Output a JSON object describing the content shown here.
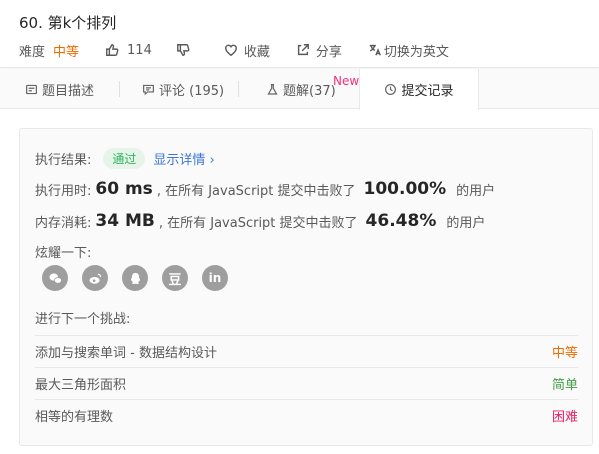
{
  "problem": {
    "title": "60. 第k个排列",
    "difficulty_label": "难度",
    "difficulty": "中等",
    "likes": "114",
    "favorite_label": "收藏",
    "share_label": "分享",
    "switch_lang_label": "切换为英文"
  },
  "tabs": [
    {
      "label": "题目描述",
      "icon": "description-icon"
    },
    {
      "label": "评论 (195)",
      "icon": "comment-icon"
    },
    {
      "label": "题解(37)",
      "icon": "flask-icon",
      "badge": "New"
    },
    {
      "label": "提交记录",
      "icon": "clock-icon",
      "active": true
    }
  ],
  "result": {
    "status_label": "执行结果:",
    "status": "通过",
    "details_link": "显示详情 ›",
    "runtime_label": "执行用时:",
    "runtime_value": "60 ms",
    "runtime_text": ", 在所有 JavaScript 提交中击败了",
    "runtime_percent": "100.00%",
    "runtime_suffix": "的用户",
    "memory_label": "内存消耗:",
    "memory_value": "34 MB",
    "memory_text": ", 在所有 JavaScript 提交中击败了",
    "memory_percent": "46.48%",
    "memory_suffix": "的用户",
    "share_label": "炫耀一下:",
    "share_icons": [
      "wechat-icon",
      "weibo-icon",
      "qq-icon",
      "douban-icon",
      "linkedin-icon"
    ],
    "douban_glyph": "豆",
    "linkedin_glyph": "in"
  },
  "next": {
    "label": "进行下一个挑战:",
    "items": [
      {
        "name": "添加与搜索单词 - 数据结构设计",
        "difficulty": "中等"
      },
      {
        "name": "最大三角形面积",
        "difficulty": "简单"
      },
      {
        "name": "相等的有理数",
        "difficulty": "困难"
      }
    ]
  },
  "colors": {
    "medium": "#ef6c00",
    "easy": "#43a047",
    "hard": "#e91e63",
    "pass": "#2db55d",
    "link": "#3c76d6"
  }
}
